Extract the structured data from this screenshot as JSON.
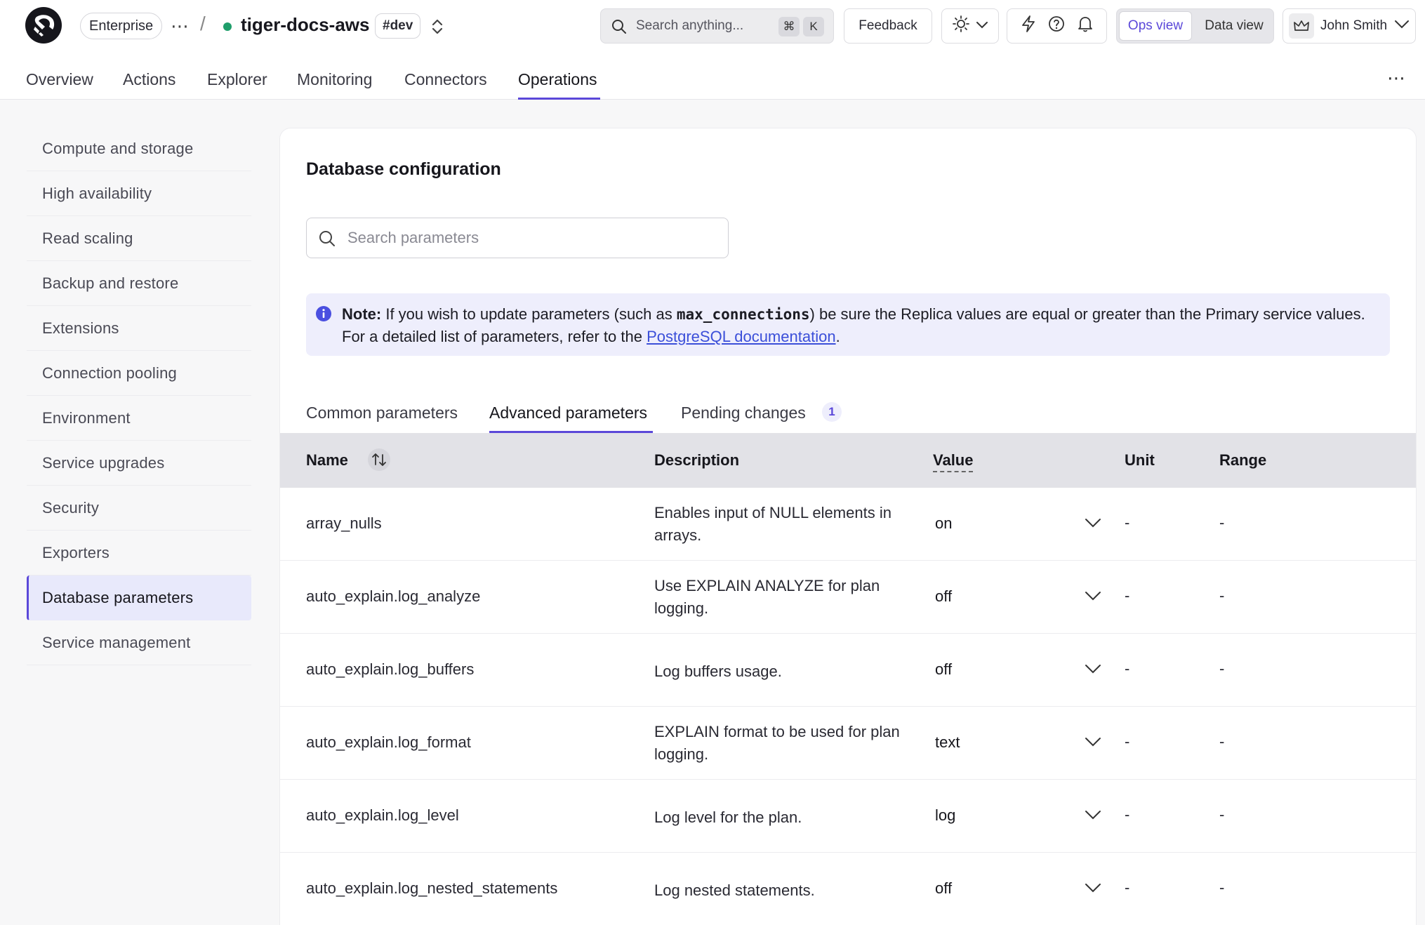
{
  "header": {
    "org_label": "Enterprise",
    "more_label": "⋯",
    "separator": "/",
    "service_name": "tiger-docs-aws",
    "service_tag": "#dev",
    "search_placeholder": "Search anything...",
    "search_kbd_cmd": "⌘",
    "search_kbd_key": "K",
    "feedback_label": "Feedback",
    "view_ops": "Ops view",
    "view_data": "Data view",
    "user_name": "John Smith"
  },
  "nav": {
    "tabs": [
      "Overview",
      "Actions",
      "Explorer",
      "Monitoring",
      "Connectors",
      "Operations"
    ],
    "active": "Operations",
    "more": "⋯"
  },
  "sidebar": {
    "items": [
      "Compute and storage",
      "High availability",
      "Read scaling",
      "Backup and restore",
      "Extensions",
      "Connection pooling",
      "Environment",
      "Service upgrades",
      "Security",
      "Exporters",
      "Database parameters",
      "Service management"
    ],
    "active": "Database parameters"
  },
  "main": {
    "title": "Database configuration",
    "search_placeholder": "Search parameters",
    "note": {
      "label": "Note:",
      "text_1": " If you wish to update parameters (such as ",
      "code": "max_connections",
      "text_2": ") be sure the Replica values are equal or greater than the Primary service values. For a detailed list of parameters, refer to the ",
      "link": "PostgreSQL documentation",
      "text_3": "."
    },
    "tabs": [
      "Common parameters",
      "Advanced parameters",
      "Pending changes"
    ],
    "active_tab": "Advanced parameters",
    "pending_count": "1",
    "columns": {
      "name": "Name",
      "description": "Description",
      "value": "Value",
      "unit": "Unit",
      "range": "Range"
    },
    "rows": [
      {
        "name": "array_nulls",
        "desc": "Enables input of NULL elements in arrays.",
        "value": "on",
        "unit": "-",
        "range": "-"
      },
      {
        "name": "auto_explain.log_analyze",
        "desc": "Use EXPLAIN ANALYZE for plan logging.",
        "value": "off",
        "unit": "-",
        "range": "-"
      },
      {
        "name": "auto_explain.log_buffers",
        "desc": "Log buffers usage.",
        "value": "off",
        "unit": "-",
        "range": "-"
      },
      {
        "name": "auto_explain.log_format",
        "desc": "EXPLAIN format to be used for plan logging.",
        "value": "text",
        "unit": "-",
        "range": "-"
      },
      {
        "name": "auto_explain.log_level",
        "desc": "Log level for the plan.",
        "value": "log",
        "unit": "-",
        "range": "-"
      },
      {
        "name": "auto_explain.log_nested_statements",
        "desc": "Log nested statements.",
        "value": "off",
        "unit": "-",
        "range": "-"
      }
    ]
  },
  "colors": {
    "accent": "#5b48d9",
    "status_dot": "#1f9e6b",
    "link": "#3b4fd9",
    "note_bg": "#eeeefc"
  }
}
